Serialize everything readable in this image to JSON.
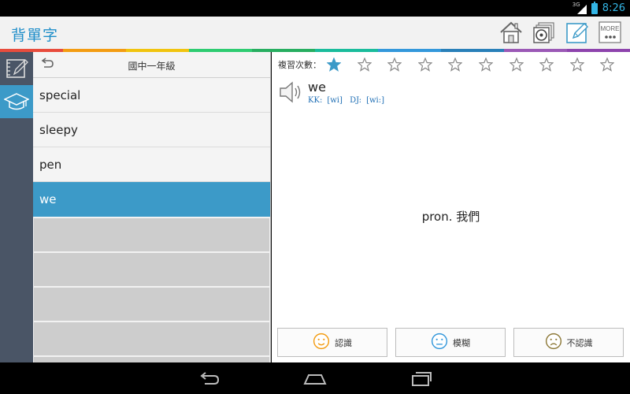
{
  "status_bar": {
    "network": "3G",
    "time": "8:26"
  },
  "app": {
    "title": "背單字"
  },
  "action_icons": [
    "home-icon",
    "cd-icon",
    "edit-icon",
    "more-icon"
  ],
  "action_more_label": "MORE",
  "rainbow_colors": [
    "#e84c3d",
    "#f39c12",
    "#f1c40f",
    "#2ecc71",
    "#27ae60",
    "#1abc9c",
    "#3498db",
    "#2980b9",
    "#9b59b6",
    "#8e44ad"
  ],
  "sidebar": {
    "items": [
      "notebook-icon",
      "graduation-cap-icon"
    ],
    "active_index": 1
  },
  "word_list": {
    "title": "國中一年級",
    "words": [
      "special",
      "sleepy",
      "pen",
      "we"
    ],
    "selected_index": 3,
    "empty_rows": 5
  },
  "detail": {
    "review_label": "複習次數：",
    "stars_total": 10,
    "stars_filled": 1,
    "word": "we",
    "kk_label": "KK:",
    "kk_value": "[wi]",
    "dj_label": "DJ:",
    "dj_value": "[wi:]",
    "definition": "pron. 我們",
    "buttons": [
      {
        "label": "認識",
        "face": "happy-face-icon",
        "color": "#f39c12"
      },
      {
        "label": "模糊",
        "face": "neutral-face-icon",
        "color": "#3498db"
      },
      {
        "label": "不認識",
        "face": "sad-face-icon",
        "color": "#8e7a3a"
      }
    ]
  },
  "colors": {
    "accent": "#3c9ac8",
    "title": "#1f8ec9",
    "star": "#3c9ac8",
    "sidebar": "#4a5566"
  }
}
